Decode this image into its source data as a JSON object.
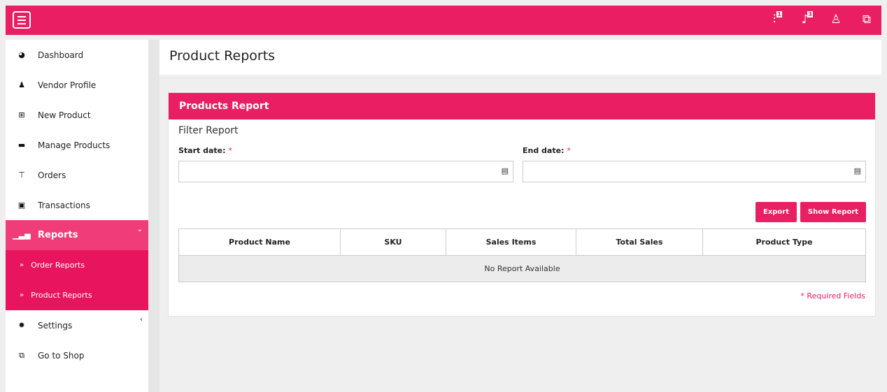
{
  "topbar": {
    "menu_icon": "hamburger-icon",
    "icons": [
      {
        "name": "sliders-icon",
        "badge": "1"
      },
      {
        "name": "bell-icon",
        "badge": "3"
      },
      {
        "name": "user-icon"
      },
      {
        "name": "external-link-icon"
      }
    ]
  },
  "sidebar": {
    "items": [
      {
        "label": "Dashboard",
        "icon": "dashboard-icon"
      },
      {
        "label": "Vendor Profile",
        "icon": "user-icon"
      },
      {
        "label": "New Product",
        "icon": "plus-square-icon"
      },
      {
        "label": "Manage Products",
        "icon": "folder-icon"
      },
      {
        "label": "Orders",
        "icon": "cart-icon"
      },
      {
        "label": "Transactions",
        "icon": "money-icon"
      },
      {
        "label": "Reports",
        "icon": "bar-chart-icon"
      },
      {
        "label": "Settings",
        "icon": "gear-icon"
      },
      {
        "label": "Go to Shop",
        "icon": "external-link-icon"
      }
    ],
    "sub_items": [
      {
        "label": "Order Reports"
      },
      {
        "label": "Product Reports"
      }
    ]
  },
  "page": {
    "title": "Product Reports"
  },
  "card": {
    "title": "Products Report",
    "filter_title": "Filter Report",
    "start_label": "Start date:",
    "end_label": "End date:",
    "required_mark": "*",
    "export_label": "Export",
    "show_report_label": "Show Report",
    "columns": [
      "Product Name",
      "SKU",
      "Sales Items",
      "Total Sales",
      "Product Type"
    ],
    "empty_text": "No Report Available",
    "required_note": "* Required Fields"
  },
  "colors": {
    "accent": "#e91e63"
  }
}
